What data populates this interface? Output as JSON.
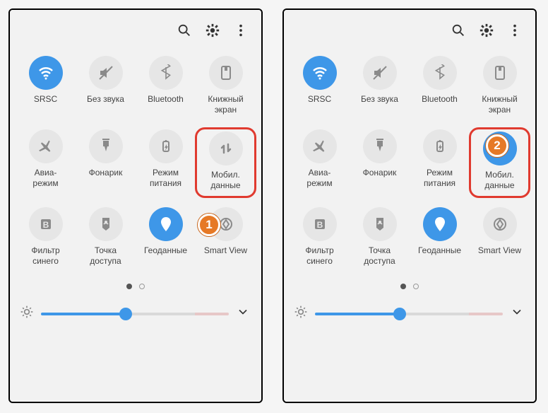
{
  "screens": [
    {
      "tiles": [
        {
          "id": "wifi",
          "label": "SRSC",
          "active": true
        },
        {
          "id": "mute",
          "label": "Без звука",
          "active": false
        },
        {
          "id": "bluetooth",
          "label": "Bluetooth",
          "active": false
        },
        {
          "id": "book",
          "label": "Книжный\nэкран",
          "active": false
        },
        {
          "id": "airplane",
          "label": "Авиа-\nрежим",
          "active": false
        },
        {
          "id": "flashlight",
          "label": "Фонарик",
          "active": false
        },
        {
          "id": "power",
          "label": "Режим\nпитания",
          "active": false
        },
        {
          "id": "mobiledata",
          "label": "Мобил.\nданные",
          "active": false,
          "highlight": true
        },
        {
          "id": "bluefilter",
          "label": "Фильтр\nсинего",
          "active": false
        },
        {
          "id": "hotspot",
          "label": "Точка\nдоступа",
          "active": false
        },
        {
          "id": "location",
          "label": "Геоданные",
          "active": true
        },
        {
          "id": "smartview",
          "label": "Smart View",
          "active": false
        }
      ],
      "badge": "1"
    },
    {
      "tiles": [
        {
          "id": "wifi",
          "label": "SRSC",
          "active": true
        },
        {
          "id": "mute",
          "label": "Без звука",
          "active": false
        },
        {
          "id": "bluetooth",
          "label": "Bluetooth",
          "active": false
        },
        {
          "id": "book",
          "label": "Книжный\nэкран",
          "active": false
        },
        {
          "id": "airplane",
          "label": "Авиа-\nрежим",
          "active": false
        },
        {
          "id": "flashlight",
          "label": "Фонарик",
          "active": false
        },
        {
          "id": "power",
          "label": "Режим\nпитания",
          "active": false
        },
        {
          "id": "mobiledata",
          "label": "Мобил.\nданные",
          "active": true,
          "highlight": true
        },
        {
          "id": "bluefilter",
          "label": "Фильтр\nсинего",
          "active": false
        },
        {
          "id": "hotspot",
          "label": "Точка\nдоступа",
          "active": false
        },
        {
          "id": "location",
          "label": "Геоданные",
          "active": true
        },
        {
          "id": "smartview",
          "label": "Smart View",
          "active": false
        }
      ],
      "badge": "2"
    }
  ],
  "pager": {
    "total": 2,
    "current": 0
  },
  "brightness": {
    "value": 45
  }
}
